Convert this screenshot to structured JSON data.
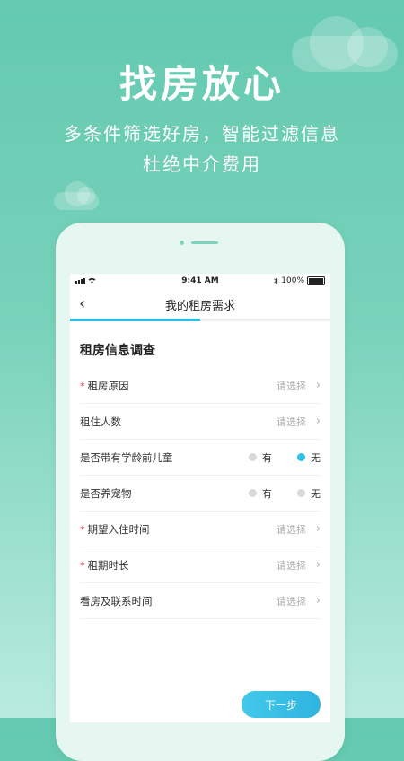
{
  "hero": {
    "title": "找房放心",
    "subtitle_line1": "多条件筛选好房，智能过滤信息",
    "subtitle_line2": "杜绝中介费用"
  },
  "status_bar": {
    "time": "9:41 AM",
    "battery": "100%",
    "bluetooth_icon": "bluetooth-icon",
    "wifi_icon": "wifi-icon"
  },
  "nav": {
    "back_glyph": "‹",
    "title": "我的租房需求"
  },
  "progress": {
    "fraction": 0.5,
    "color": "#2bc0e5"
  },
  "form": {
    "section_title": "租房信息调查",
    "rows": [
      {
        "label": "租房原因",
        "required": true,
        "placeholder": "请选择",
        "type": "select"
      },
      {
        "label": "租住人数",
        "required": false,
        "placeholder": "请选择",
        "type": "select"
      },
      {
        "label": "是否带有学龄前儿童",
        "required": false,
        "type": "radio",
        "options": [
          "有",
          "无"
        ],
        "selected": "无"
      },
      {
        "label": "是否养宠物",
        "required": false,
        "type": "radio",
        "options": [
          "有",
          "无"
        ],
        "selected": null
      },
      {
        "label": "期望入住时间",
        "required": true,
        "placeholder": "请选择",
        "type": "select"
      },
      {
        "label": "租期时长",
        "required": true,
        "placeholder": "请选择",
        "type": "select"
      },
      {
        "label": "看房及联系时间",
        "required": false,
        "placeholder": "请选择",
        "type": "select"
      }
    ],
    "required_mark": "*",
    "chevron": "›"
  },
  "next_button": {
    "label": "下一步"
  },
  "colors": {
    "accent": "#2bc0e5",
    "background": "#63c9b0",
    "required": "#e84a5f"
  }
}
